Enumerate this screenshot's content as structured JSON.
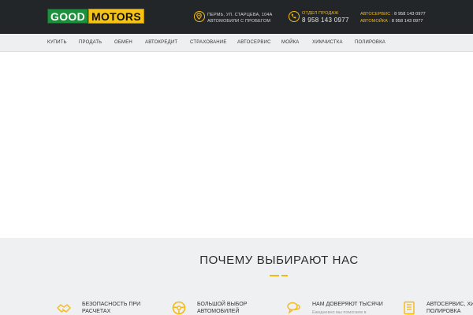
{
  "header": {
    "logo": {
      "word1": "GOOD",
      "word2": "MOTORS"
    },
    "address": {
      "line1": "ПЕРМЬ, УЛ. СТАРЦЕВА, 104А",
      "line2": "АВТОМОБИЛИ С ПРОБЕГОМ",
      "icon": "location-pin-icon"
    },
    "sales": {
      "label": "ОТДЕЛ ПРОДАЖ",
      "phone": "8 958 143 0977",
      "icon": "phone-icon"
    },
    "services": [
      {
        "key": "АВТОСЕРВИС :",
        "value": "8 958 143 0977"
      },
      {
        "key": "АВТОМОЙКА :",
        "value": "8 958 143 0977"
      }
    ]
  },
  "nav": {
    "items": [
      {
        "label": "КУПИТЬ"
      },
      {
        "label": "ПРОДАТЬ"
      },
      {
        "label": "ОБМЕН"
      },
      {
        "label": "АВТОКРЕДИТ"
      },
      {
        "label": "СТРАХОВАНИЕ"
      },
      {
        "label": "АВТОСЕРВИС"
      },
      {
        "label": "МОЙКА"
      },
      {
        "label": "ХИМЧИСТКА"
      },
      {
        "label": "ПОЛИРОВКА"
      }
    ]
  },
  "why": {
    "title": "ПОЧЕМУ ВЫБИРАЮТ НАС",
    "features": [
      {
        "line1": "БЕЗОПАСНОСТЬ ПРИ",
        "line2": "РАСЧЕТАХ",
        "icon": "handshake-icon"
      },
      {
        "line1": "БОЛЬШОЙ ВЫБОР",
        "line2": "АВТОМОБИЛЕЙ",
        "icon": "steering-wheel-icon"
      },
      {
        "line1": "НАМ ДОВЕРЯЮТ ТЫСЯЧИ",
        "sub": "Ежедневно мы помогаем в",
        "icon": "chat-bubbles-icon"
      },
      {
        "line1": "АВТОСЕРВИС, ХИМ",
        "line2": "ПОЛИРОВКА",
        "icon": "document-icon"
      }
    ]
  },
  "colors": {
    "header_bg": "#232628",
    "accent": "#f5b914",
    "nav_bg": "#eeeff1",
    "section_bg": "#eff0f2",
    "logo_green": "#1e8f3c",
    "logo_yellow": "#f5c218"
  }
}
